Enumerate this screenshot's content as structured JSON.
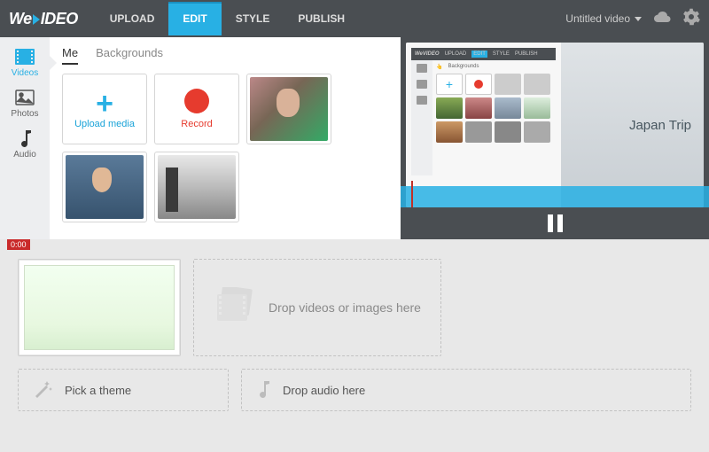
{
  "topbar": {
    "logo_pre": "We",
    "logo_post": "IDEO",
    "nav": {
      "upload": "UPLOAD",
      "edit": "EDIT",
      "style": "STYLE",
      "publish": "PUBLISH"
    },
    "project_title": "Untitled video"
  },
  "sidebar": {
    "videos": "Videos",
    "photos": "Photos",
    "audio": "Audio"
  },
  "media": {
    "tabs": {
      "me": "Me",
      "backgrounds": "Backgrounds"
    },
    "upload_label": "Upload media",
    "record_label": "Record"
  },
  "preview": {
    "mini_nav": {
      "upload": "UPLOAD",
      "edit": "EDIT",
      "style": "STYLE",
      "publish": "PUBLISH"
    },
    "mini_tabs": {
      "me": "Me",
      "backgrounds": "Backgrounds"
    },
    "title_overlay": "Japan Trip"
  },
  "timeline": {
    "time_start": "0:00",
    "drop_videos_label": "Drop videos or images here",
    "pick_theme_label": "Pick a theme",
    "drop_audio_label": "Drop audio here"
  }
}
